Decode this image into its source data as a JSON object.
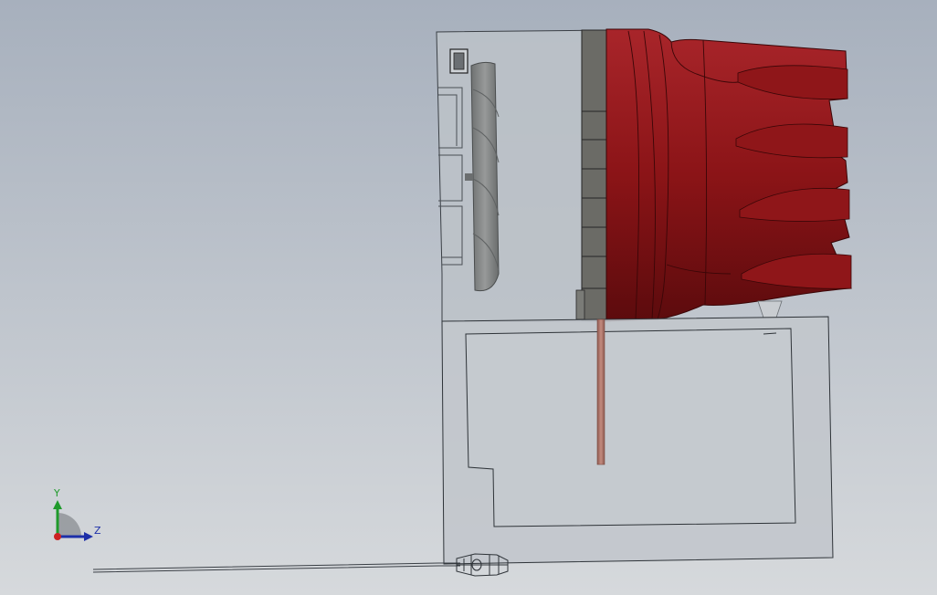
{
  "viewport": {
    "background_top": "#a7b0bd",
    "background_bottom": "#d6d9dc"
  },
  "colors": {
    "housing_fill": "#bcc2c8",
    "housing_stroke": "#3a3f45",
    "base_fill": "#c2c7cc",
    "edge_stroke": "#2e3338",
    "fan_fill": "#8b8d8d",
    "fan_shadow": "#5f6263",
    "heatsink_fill": "#6b6b66",
    "heatsink_stroke": "#262626",
    "fins_fill": "#8b1417",
    "fins_highlight": "#a8252a",
    "fins_shadow": "#5c0b0d",
    "rod_fill": "#b07a6f",
    "cable_stroke": "#3a3f45",
    "axis_x": "#cc2222",
    "axis_y": "#1f9a2b",
    "axis_z": "#1d2fa8"
  },
  "triad": {
    "y_label": "Y",
    "z_label": "Z",
    "icon": "coordinate-triad-icon"
  }
}
